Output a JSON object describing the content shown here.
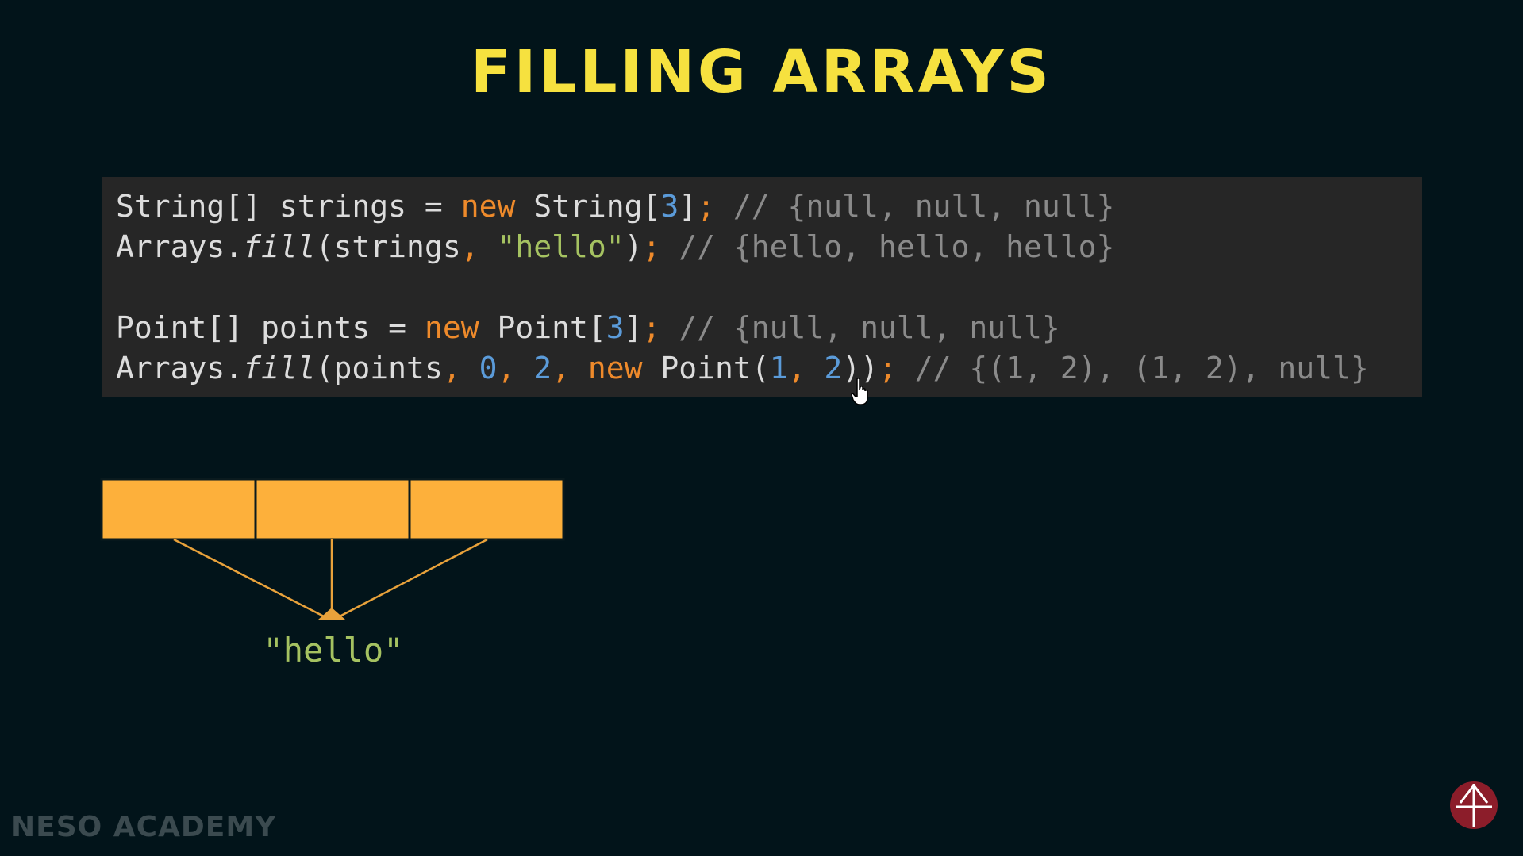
{
  "slide": {
    "title": "FILLING ARRAYS",
    "brand": "NESO ACADEMY"
  },
  "code": {
    "line1": {
      "t1": "String[] strings = ",
      "kw": "new",
      "t2": " String[",
      "num": "3",
      "t3": "]",
      "semi": ";",
      "comment": " // {null, null, null}"
    },
    "line2": {
      "t1": "Arrays.",
      "method": "fill",
      "t2": "(strings",
      "comma": ",",
      "str": " \"hello\"",
      "t3": ")",
      "semi": ";",
      "comment": " // {hello, hello, hello}"
    },
    "line3": {
      "t1": "Point[] points = ",
      "kw": "new",
      "t2": " Point[",
      "num": "3",
      "t3": "]",
      "semi": ";",
      "comment": " // {null, null, null}"
    },
    "line4": {
      "t1": "Arrays.",
      "method": "fill",
      "t2": "(points",
      "c1": ",",
      "n1": " 0",
      "c2": ",",
      "n2": " 2",
      "c3": ",",
      "kw": " new",
      "t3": " Point(",
      "n3": "1",
      "c4": ",",
      "n4": " 2",
      "t4": "))",
      "semi": ";",
      "comment": " // {(1, 2), (1, 2), null}"
    }
  },
  "diagram": {
    "cell_count": 3,
    "target_label": "\"hello\"",
    "colors": {
      "cell_fill": "#fdb03b",
      "cell_border": "#0a1a1e",
      "arrow": "#e9a23b"
    }
  },
  "colors": {
    "background": "#02141a",
    "title": "#f6e13f",
    "code_bg": "#262626",
    "keyword": "#ee8a2b",
    "number": "#5b9bd9",
    "string": "#a5c261",
    "comment": "#8a8a8a"
  },
  "icons": {
    "logo": "neso-academy-logo",
    "cursor": "hand-pointer-icon"
  }
}
